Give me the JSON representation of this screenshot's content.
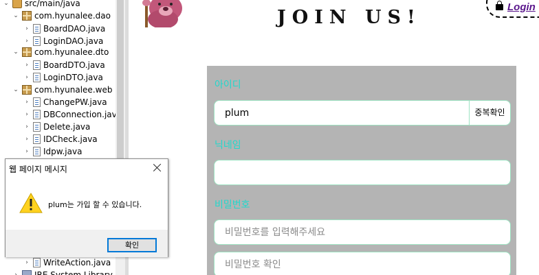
{
  "explorer": {
    "items": [
      {
        "label": "src/main/java",
        "kind": "src",
        "expanded": true,
        "depth": 0
      },
      {
        "label": "com.hyunalee.dao",
        "kind": "package",
        "expanded": true,
        "depth": 1
      },
      {
        "label": "BoardDAO.java",
        "kind": "file",
        "depth": 2
      },
      {
        "label": "LoginDAO.java",
        "kind": "file",
        "depth": 2
      },
      {
        "label": "com.hyunalee.dto",
        "kind": "package",
        "expanded": true,
        "depth": 1
      },
      {
        "label": "BoardDTO.java",
        "kind": "file",
        "depth": 2
      },
      {
        "label": "LoginDTO.java",
        "kind": "file",
        "depth": 2
      },
      {
        "label": "com.hyunalee.web",
        "kind": "package",
        "expanded": true,
        "depth": 1
      },
      {
        "label": "ChangePW.java",
        "kind": "file",
        "depth": 2
      },
      {
        "label": "DBConnection.java",
        "kind": "file",
        "depth": 2
      },
      {
        "label": "Delete.java",
        "kind": "file",
        "depth": 2
      },
      {
        "label": "IDCheck.java",
        "kind": "file",
        "depth": 2
      },
      {
        "label": "Idpw.java",
        "kind": "file",
        "depth": 2
      },
      {
        "label": "WriteAction.java",
        "kind": "file",
        "depth": 2
      },
      {
        "label": "JRE System Library [Jav",
        "kind": "library",
        "depth": 0
      }
    ]
  },
  "webpage": {
    "title": "JOIN US!",
    "login_label": "Login",
    "form": {
      "id_label": "아이디",
      "id_value": "plum",
      "dup_check_label": "중복확인",
      "nickname_label": "닉네임",
      "nickname_value": "",
      "password_label": "비밀번호",
      "password_placeholder": "비밀번호를 입력해주세요",
      "password_confirm_placeholder": "비밀번호 확인"
    }
  },
  "dialog": {
    "title": "웹 페이지 메시지",
    "message": "plum는 가입 할 수 있습니다.",
    "ok_label": "확인",
    "icon": "warning-icon"
  },
  "colors": {
    "form_background": "#b4b4b4",
    "form_label": "#20d8cc",
    "field_border": "#9de3c2",
    "login_link": "#5a168c",
    "dialog_button_border": "#0078d7"
  }
}
